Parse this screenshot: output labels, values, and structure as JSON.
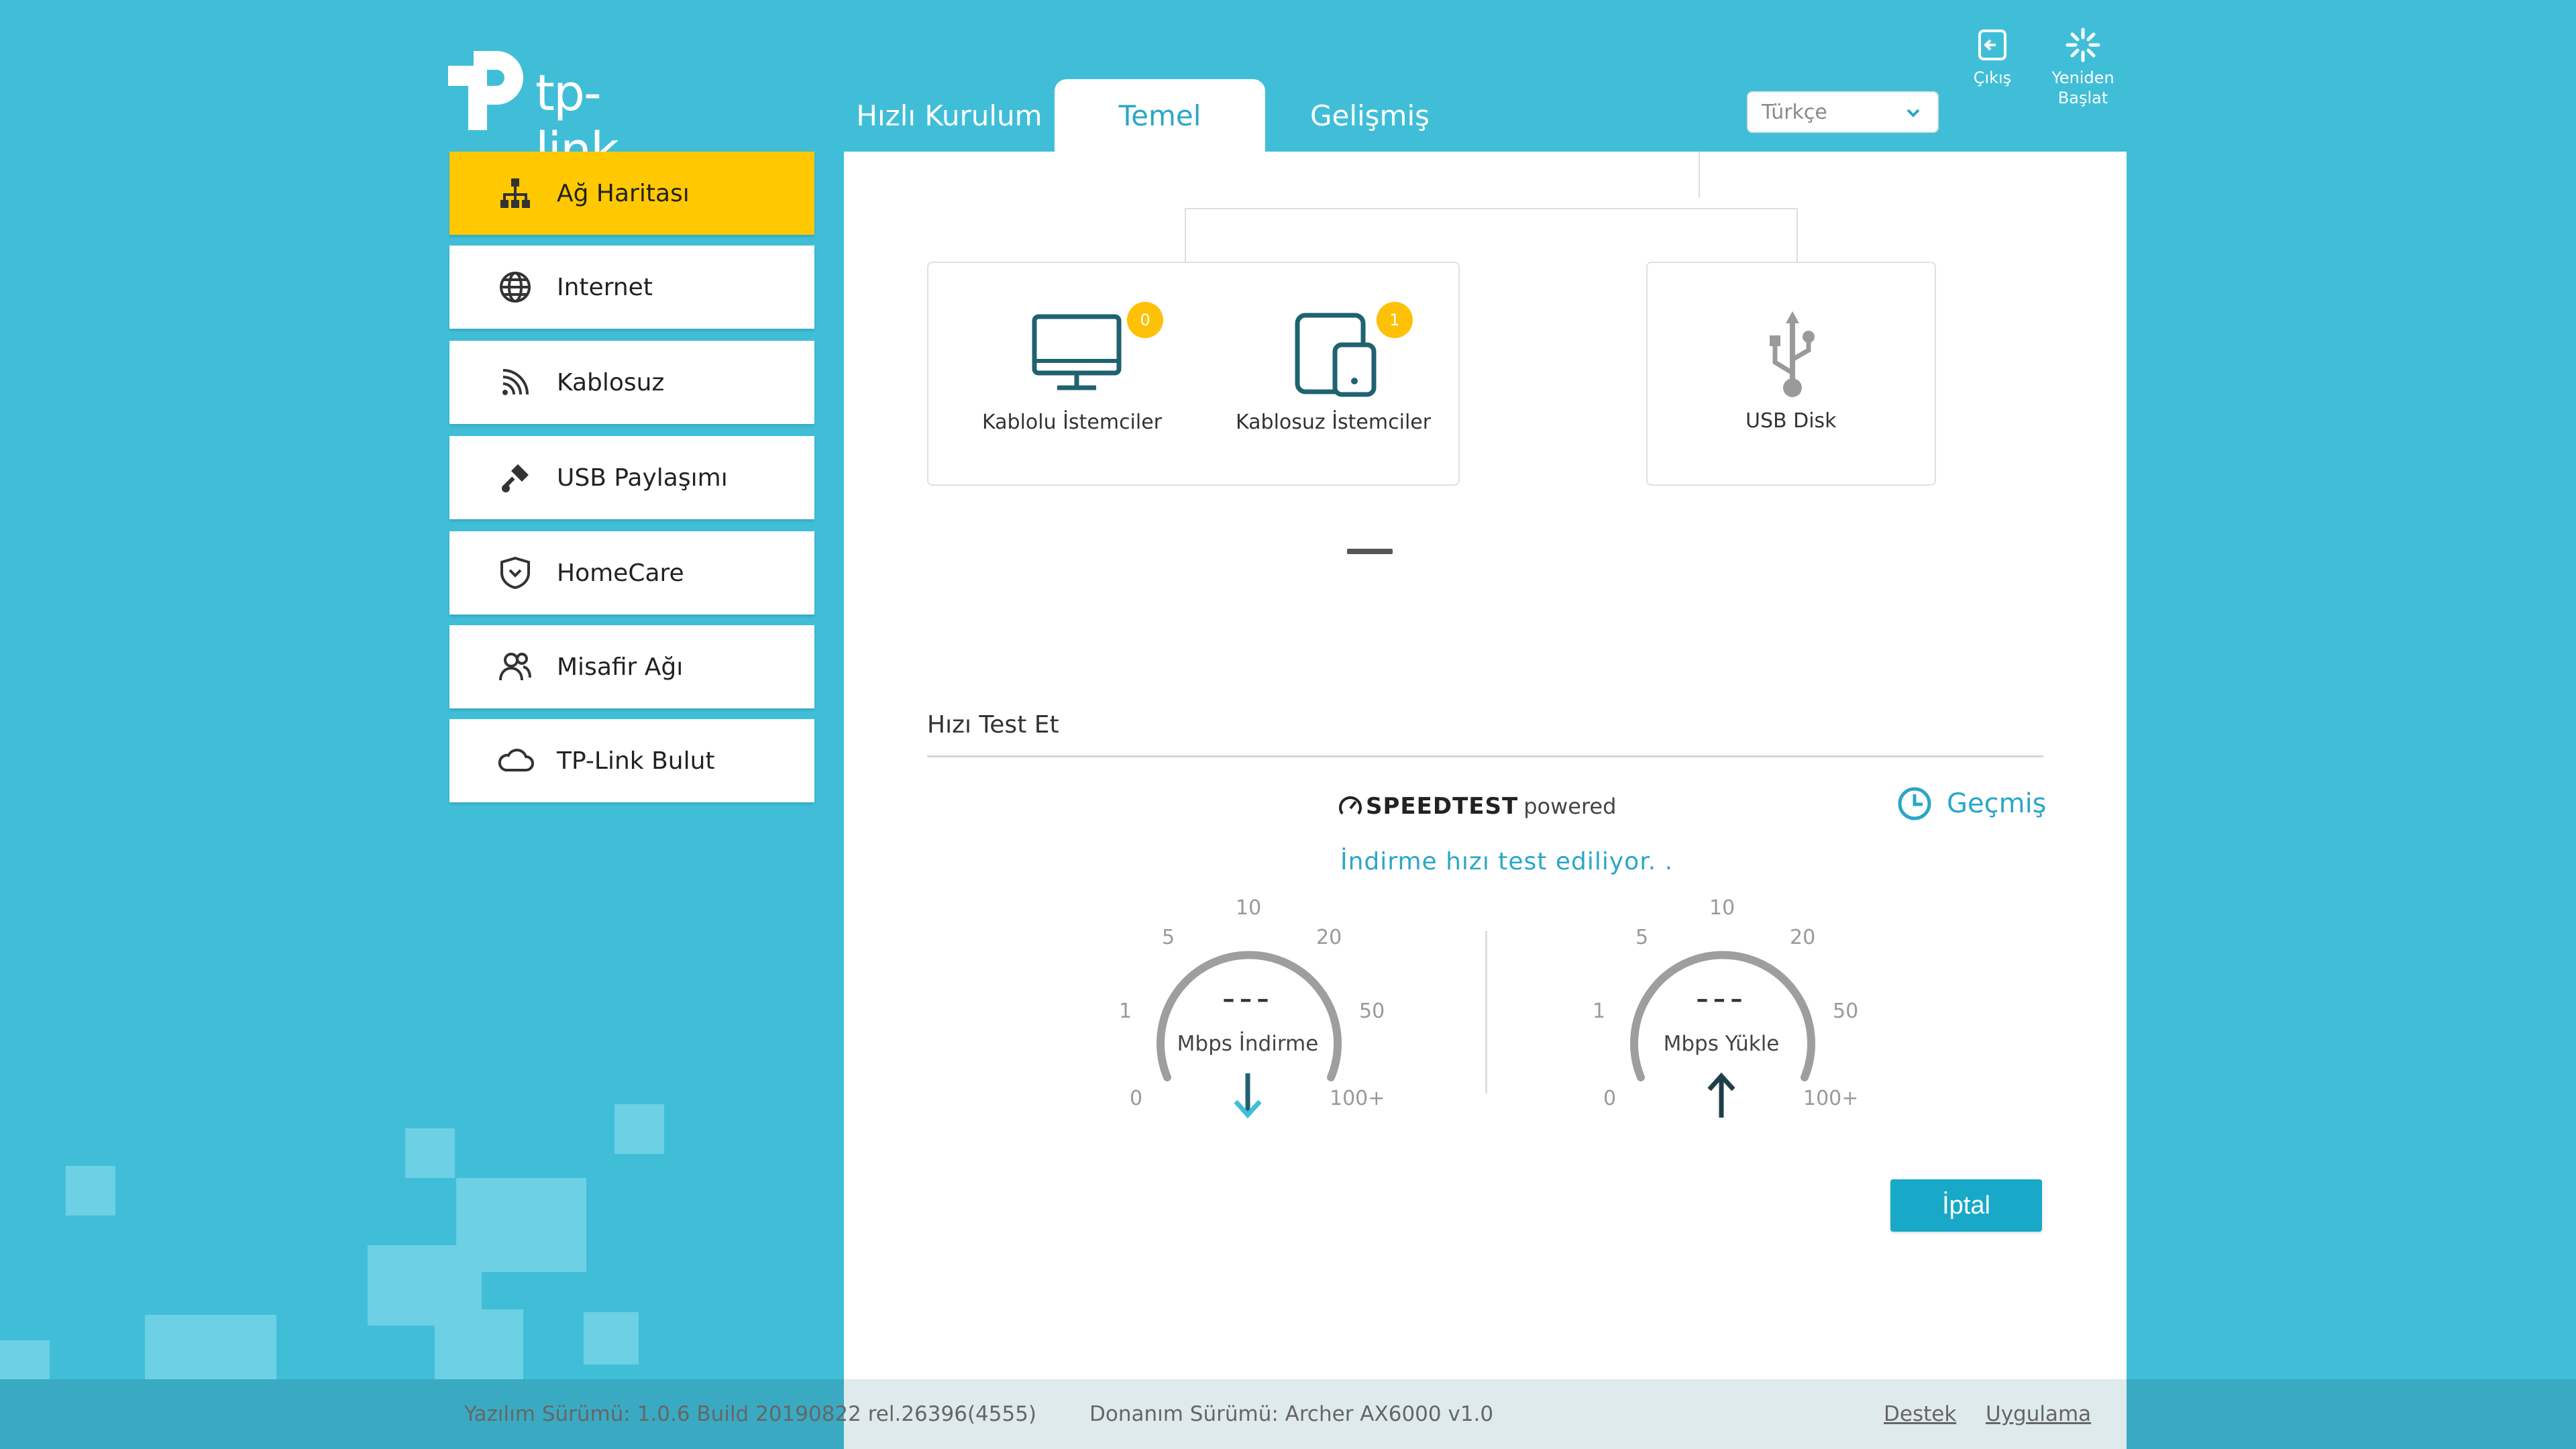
{
  "brand": {
    "logo_text": "tp-link",
    "accent": "#40bed8",
    "active_tab_color": "#2aa7c7",
    "highlight": "#ffc800"
  },
  "tabs": [
    {
      "label": "Hızlı Kurulum",
      "active": false
    },
    {
      "label": "Temel",
      "active": true
    },
    {
      "label": "Gelişmiş",
      "active": false
    }
  ],
  "language": {
    "selected": "Türkçe"
  },
  "top_actions": {
    "logout_label": "Çıkış",
    "reboot_label_line1": "Yeniden",
    "reboot_label_line2": "Başlat"
  },
  "sidebar": {
    "items": [
      {
        "label": "Ağ Haritası",
        "icon": "network-map-icon",
        "active": true
      },
      {
        "label": "Internet",
        "icon": "globe-icon",
        "active": false
      },
      {
        "label": "Kablosuz",
        "icon": "wireless-icon",
        "active": false
      },
      {
        "label": "USB Paylaşımı",
        "icon": "usb-share-icon",
        "active": false
      },
      {
        "label": "HomeCare",
        "icon": "shield-icon",
        "active": false
      },
      {
        "label": "Misafir Ağı",
        "icon": "guest-users-icon",
        "active": false
      },
      {
        "label": "TP-Link Bulut",
        "icon": "cloud-icon",
        "active": false
      }
    ]
  },
  "network_map": {
    "wired_clients": {
      "label": "Kablolu İstemciler",
      "count": "0"
    },
    "wireless_clients": {
      "label": "Kablosuz İstemciler",
      "count": "1"
    },
    "usb_disk": {
      "label": "USB Disk"
    }
  },
  "speedtest": {
    "section_title": "Hızı Test Et",
    "brand_text": "SPEEDTEST",
    "brand_suffix": "powered",
    "history_label": "Geçmiş",
    "status": "İndirme hızı test ediliyor. .",
    "download": {
      "value": "---",
      "unit_label": "Mbps İndirme",
      "scale": [
        "0",
        "1",
        "5",
        "10",
        "20",
        "50",
        "100+"
      ]
    },
    "upload": {
      "value": "---",
      "unit_label": "Mbps Yükle",
      "scale": [
        "0",
        "1",
        "5",
        "10",
        "20",
        "50",
        "100+"
      ]
    },
    "cancel_label": "İptal"
  },
  "footer": {
    "firmware": "Yazılım Sürümü: 1.0.6 Build 20190822 rel.26396(4555)",
    "hardware": "Donanım Sürümü: Archer AX6000 v1.0",
    "support_link": "Destek",
    "app_link": "Uygulama"
  }
}
